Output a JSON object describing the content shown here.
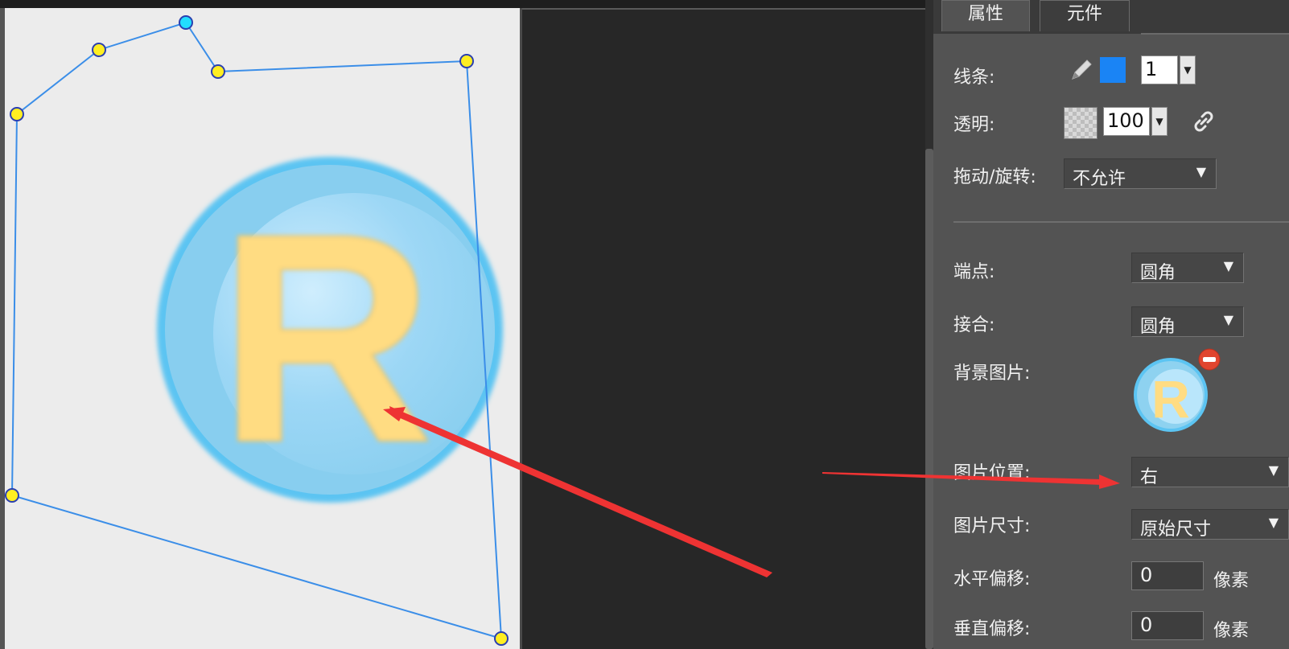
{
  "tabs": [
    {
      "label": "属性",
      "active": true
    },
    {
      "label": "元件",
      "active": false
    }
  ],
  "stroke": {
    "label": "线条:",
    "color": "#1a84f5",
    "width": "1"
  },
  "opacity": {
    "label": "透明:",
    "value": "100"
  },
  "drag_rotate": {
    "label": "拖动/旋转:",
    "value": "不允许"
  },
  "cap": {
    "label": "端点:",
    "value": "圆角"
  },
  "join": {
    "label": "接合:",
    "value": "圆角"
  },
  "bg_image": {
    "label": "背景图片:",
    "letter": "R"
  },
  "image_position": {
    "label": "图片位置:",
    "value": "右"
  },
  "image_size": {
    "label": "图片尺寸:",
    "value": "原始尺寸"
  },
  "h_offset": {
    "label": "水平偏移:",
    "value": "0",
    "unit": "像素"
  },
  "v_offset": {
    "label": "垂直偏移:",
    "value": "0",
    "unit": "像素"
  },
  "canvas": {
    "logo_letter": "R"
  },
  "icons": {
    "pencil": "pencil-icon",
    "link": "link-icon",
    "remove": "remove-icon",
    "dropdown": "▼"
  },
  "colors": {
    "shape_outline": "#3b8ee8",
    "vertex_fill": "#ffee22",
    "vertex_selected": "#22ddff",
    "annotation_arrow": "#ee3333"
  }
}
